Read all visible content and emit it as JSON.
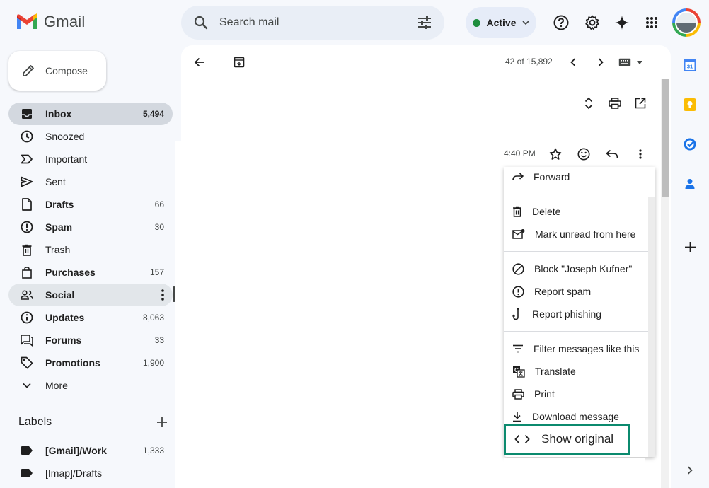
{
  "header": {
    "logo_text": "Gmail",
    "search_placeholder": "Search mail",
    "status_label": "Active"
  },
  "compose": {
    "label": "Compose"
  },
  "sidebar": {
    "items": [
      {
        "label": "Inbox",
        "count": "5,494",
        "icon": "inbox-icon"
      },
      {
        "label": "Snoozed",
        "count": "",
        "icon": "clock-icon"
      },
      {
        "label": "Important",
        "count": "",
        "icon": "important-icon"
      },
      {
        "label": "Sent",
        "count": "",
        "icon": "send-icon"
      },
      {
        "label": "Drafts",
        "count": "66",
        "icon": "draft-icon"
      },
      {
        "label": "Spam",
        "count": "30",
        "icon": "spam-icon"
      },
      {
        "label": "Trash",
        "count": "",
        "icon": "trash-icon"
      },
      {
        "label": "Purchases",
        "count": "157",
        "icon": "bag-icon"
      },
      {
        "label": "Social",
        "count": "",
        "icon": "people-icon"
      },
      {
        "label": "Updates",
        "count": "8,063",
        "icon": "info-icon"
      },
      {
        "label": "Forums",
        "count": "33",
        "icon": "forum-icon"
      },
      {
        "label": "Promotions",
        "count": "1,900",
        "icon": "tag-icon"
      },
      {
        "label": "More",
        "count": "",
        "icon": "chevron-down-icon"
      }
    ],
    "labels_title": "Labels",
    "labels": [
      {
        "label": "[Gmail]/Work",
        "count": "1,333"
      },
      {
        "label": "[Imap]/Drafts",
        "count": ""
      }
    ]
  },
  "toolbar": {
    "count_label": "42 of 15,892"
  },
  "message": {
    "time": "4:40 PM"
  },
  "menu": {
    "items": [
      {
        "label": "Forward",
        "icon": "forward-icon"
      },
      {
        "label": "Delete",
        "icon": "trash-icon"
      },
      {
        "label": "Mark unread from here",
        "icon": "mark-unread-icon"
      },
      {
        "label": "Block \"Joseph Kufner\"",
        "icon": "block-icon"
      },
      {
        "label": "Report spam",
        "icon": "spam-icon"
      },
      {
        "label": "Report phishing",
        "icon": "phishing-hook-icon"
      },
      {
        "label": "Filter messages like this",
        "icon": "filter-icon"
      },
      {
        "label": "Translate",
        "icon": "translate-icon"
      },
      {
        "label": "Print",
        "icon": "print-icon"
      },
      {
        "label": "Download message",
        "icon": "download-icon"
      },
      {
        "label": "Show original",
        "icon": "code-icon"
      }
    ]
  },
  "colors": {
    "highlight_border": "#0b8a6e",
    "active_dot": "#1e8e3e",
    "selected_nav": "#d3d8df"
  }
}
